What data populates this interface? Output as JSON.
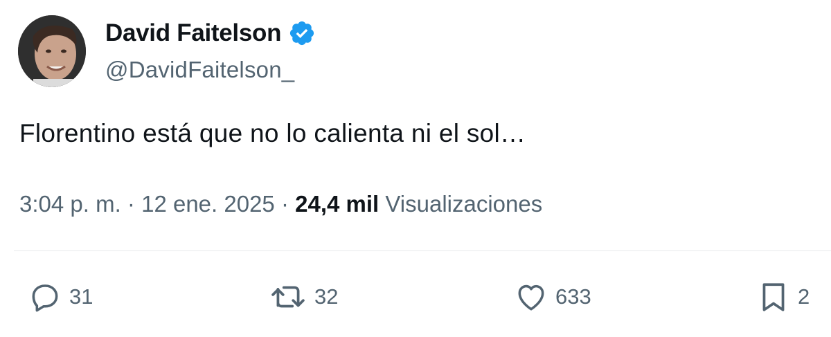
{
  "author": {
    "display_name": "David Faitelson",
    "handle": "@DavidFaitelson_",
    "verified_icon": "verified-badge-icon",
    "verified_color": "#1d9bf0"
  },
  "tweet": {
    "text": "Florentino está que no lo calienta ni el sol…"
  },
  "meta": {
    "time": "3:04 p. m.",
    "separator": "·",
    "date": "12 ene. 2025",
    "views_count": "24,4 mil",
    "views_label": "Visualizaciones"
  },
  "actions": {
    "reply": {
      "icon": "reply-icon",
      "count": "31"
    },
    "retweet": {
      "icon": "retweet-icon",
      "count": "32"
    },
    "like": {
      "icon": "heart-icon",
      "count": "633"
    },
    "bookmark": {
      "icon": "bookmark-icon",
      "count": "2"
    }
  },
  "colors": {
    "text_primary": "#0f1419",
    "text_secondary": "#536471",
    "divider": "#e6e9eb"
  }
}
